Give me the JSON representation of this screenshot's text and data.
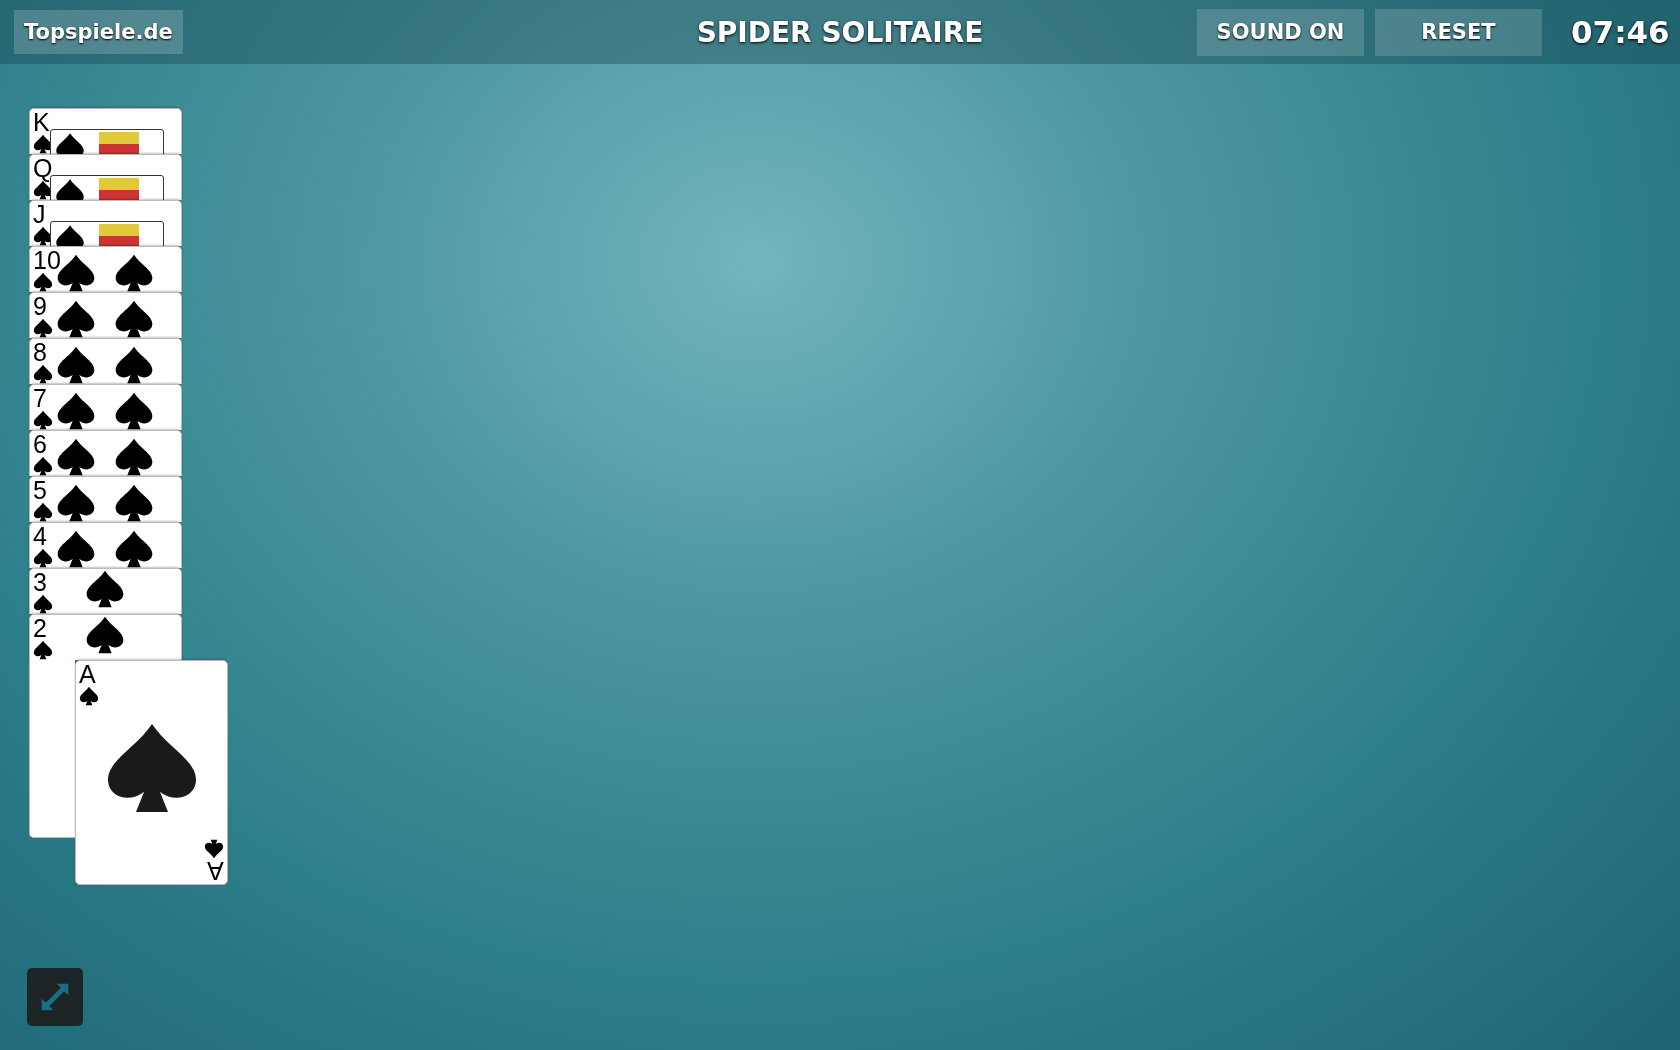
{
  "header": {
    "logo": "Topspiele.de",
    "title": "SPIDER SOLITAIRE",
    "buttons": [
      "SOUND ON",
      "RESET"
    ],
    "timer": "07:46"
  },
  "column": [
    {
      "rank": "K",
      "kind": "face"
    },
    {
      "rank": "Q",
      "kind": "face"
    },
    {
      "rank": "J",
      "kind": "face"
    },
    {
      "rank": "10",
      "kind": "pair"
    },
    {
      "rank": "9",
      "kind": "pair"
    },
    {
      "rank": "8",
      "kind": "pair"
    },
    {
      "rank": "7",
      "kind": "pair"
    },
    {
      "rank": "6",
      "kind": "pair"
    },
    {
      "rank": "5",
      "kind": "pair"
    },
    {
      "rank": "4",
      "kind": "pair"
    },
    {
      "rank": "3",
      "kind": "single"
    },
    {
      "rank": "2",
      "kind": "single"
    },
    {
      "rank": "A",
      "kind": "ace",
      "rank_bottom": "A"
    }
  ]
}
